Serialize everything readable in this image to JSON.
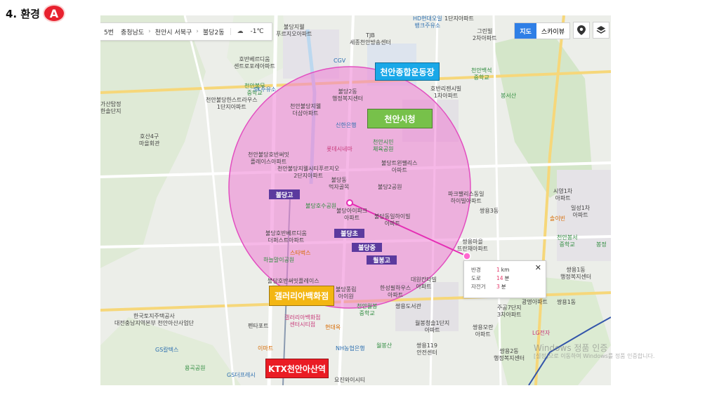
{
  "section": {
    "title": "4. 환경",
    "badge": "A"
  },
  "breadcrumb": {
    "prev_fragment": "5번",
    "province": "충청남도",
    "city": "천안시 서북구",
    "dong": "불당2동",
    "weather": "-1℃"
  },
  "map_controls": {
    "map_label": "지도",
    "skyview_label": "스카이뷰"
  },
  "info_box": {
    "radius_label": "반경",
    "radius_value": "1",
    "radius_unit": "km",
    "road_label": "도로",
    "road_value": "14",
    "road_unit": "분",
    "bike_label": "자전거",
    "bike_value": "3",
    "bike_unit": "분"
  },
  "highlights": {
    "stadium": "천안종합운동장",
    "city_hall": "천안시청",
    "galleria": "갤러리아백화점",
    "ktx": "KTX천안아산역"
  },
  "schools": {
    "bd_high": "불당고",
    "bd_elem": "불당초",
    "bd_mid": "불당중",
    "wb_high": "월봉고"
  },
  "colors": {
    "stadium_bg": "#19a8e8",
    "city_hall_bg": "#77c14a",
    "galleria_bg": "#f3b613",
    "ktx_bg": "#ea1c24",
    "radius_fill": "#ee7ed4"
  },
  "map_labels": {
    "l01": "불당지웰\n푸르지오아파트",
    "l02": "TJB\n세종천안방송센터",
    "l03": "HD현대오일\n뱅크주유소",
    "l04": "1단지아파트",
    "l05": "그린빌\n2차아파트",
    "l06": "호반베르디움\n센트로포레아파트",
    "l07": "CGV",
    "l08": "천안백석\n중학교",
    "l09": "천안불무\n중학교",
    "l10": "SK주유소",
    "l11": "불당2동\n행정복지센터",
    "l12": "호반리젠시빌\n1차아파트",
    "l13": "봉서산",
    "l14": "천안불당한스트라우스\n1단지아파트",
    "l15": "천안불당지웰\n더샵아파트",
    "l16": "신한은행",
    "l17": "가산탑정\n한솔단지",
    "l18": "호산4구\n마을회관",
    "l19": "천안시민\n체육공원",
    "l20": "롯데시네마",
    "l21": "천안불당호반써밋\n플레이스아파트",
    "l22": "천안불당지웰시티푸르지오\n2단지아파트",
    "l23": "불당트윈팰리스\n아파트",
    "l24": "불당동\n먹자골목",
    "l25": "불당2공원",
    "l26": "파크팰리스동일\n하이빌아파트",
    "l27": "불당호수공원",
    "l28": "불당아이파크\n아파트",
    "l29": "불당동일하이빌\n아파트",
    "l30": "쌍용3동",
    "l31": "시영1차\n아파트",
    "l32": "일성1차\n아파트",
    "l33": "천안봉서\n중학교",
    "l34": "불당호반베르디움\n더퍼스트아파트",
    "l35": "쌍용1동\n행정복지센터",
    "l36": "쌍용마을\n뜨란채아파트",
    "l37": "하늘말이공원",
    "l38": "불당호반써밋플레이스",
    "l39": "불당풍림\n아이원",
    "l40": "한성필하우스\n아파트",
    "l41": "대원칸타빌\n아파트",
    "l42": "천안월봉\n중학교",
    "l43": "쌍용도서관",
    "l44": "주공7단지\n3차아파트",
    "l45": "한국토지주택공사\n대전충남지역본부 천안아산사업단",
    "l46": "펜타포트",
    "l47": "갤러리아백화점\n센터시티점",
    "l48": "현대옥",
    "l49": "월봉청솔1단지\n아파트",
    "l50": "쌍용모란\n아파트",
    "l51": "LG전자",
    "l52": "GS칼텍스",
    "l53": "NH농협은행",
    "l54": "월봉산",
    "l55": "쌍용119\n안전센터",
    "l56": "쌍용2동\n행정복지센터",
    "l57": "용곡공원",
    "l58": "GS더프레시",
    "l59": "요진와이시티",
    "l60": "광명아파트",
    "l61": "쌍용1동",
    "l62": "스타벅스",
    "l63": "이마트",
    "l64": "솔이빈",
    "l65": "봉정"
  },
  "watermark": {
    "line1": "Windows 정품 인증",
    "line2": "[설정]으로 이동하여 Windows를 정품 인증합니다."
  }
}
